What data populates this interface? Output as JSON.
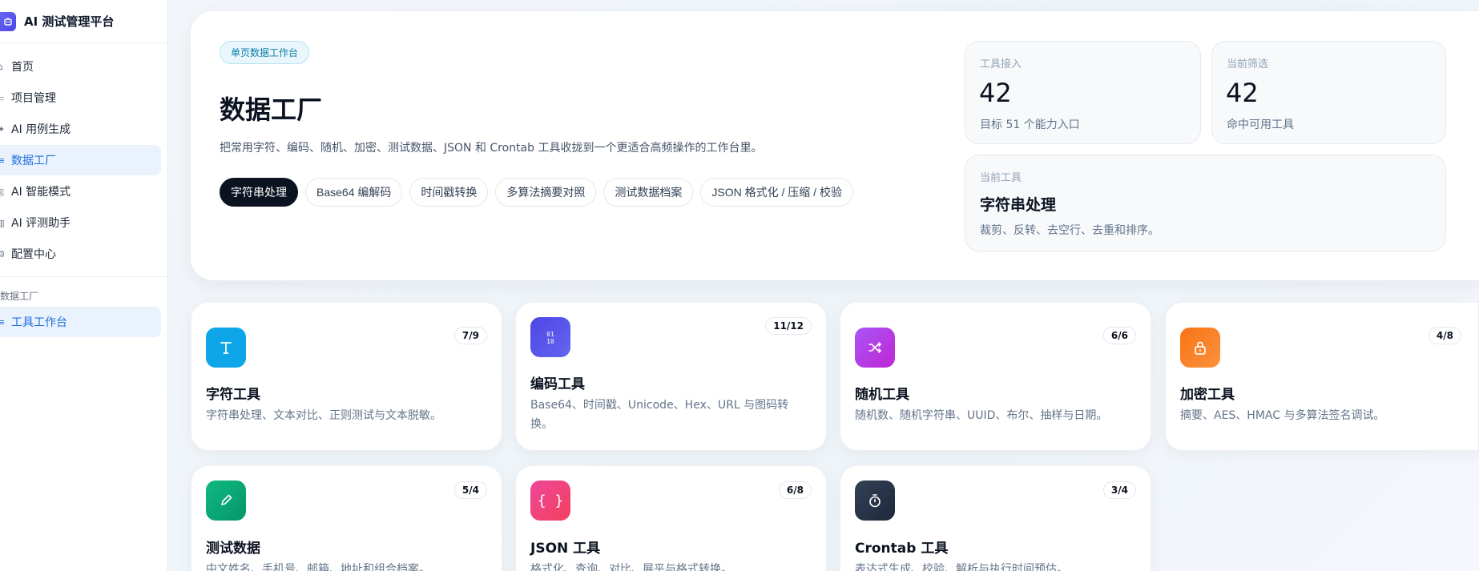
{
  "sidebar": {
    "brand": "AI 测试管理平台",
    "items": [
      {
        "label": "首页",
        "active": false
      },
      {
        "label": "项目管理",
        "active": false
      },
      {
        "label": "AI 用例生成",
        "active": false
      },
      {
        "label": "数据工厂",
        "active": true
      },
      {
        "label": "AI 智能模式",
        "active": false
      },
      {
        "label": "AI 评测助手",
        "active": false
      },
      {
        "label": "配置中心",
        "active": false
      }
    ],
    "section_title": "数据工厂",
    "section_items": [
      {
        "label": "工具工作台",
        "active": true
      }
    ]
  },
  "hero": {
    "tag": "单页数据工作台",
    "title": "数据工厂",
    "description": "把常用字符、编码、随机、加密、测试数据、JSON 和 Crontab 工具收拢到一个更适合高频操作的工作台里。",
    "chips": [
      {
        "label": "字符串处理",
        "active": true
      },
      {
        "label": "Base64 编解码",
        "active": false
      },
      {
        "label": "时间戳转换",
        "active": false
      },
      {
        "label": "多算法摘要对照",
        "active": false
      },
      {
        "label": "测试数据档案",
        "active": false
      },
      {
        "label": "JSON 格式化 / 压缩 / 校验",
        "active": false
      }
    ]
  },
  "stats": {
    "tools": {
      "label": "工具接入",
      "value": "42",
      "sub": "目标 51 个能力入口"
    },
    "filter": {
      "label": "当前筛选",
      "value": "42",
      "sub": "命中可用工具"
    },
    "current": {
      "label": "当前工具",
      "name": "字符串处理",
      "sub": "裁剪、反转、去空行、去重和排序。"
    }
  },
  "cards": [
    {
      "title": "字符工具",
      "desc": "字符串处理、文本对比、正则测试与文本脱敏。",
      "badge": "7/9",
      "icon": "text-icon",
      "color": "#0ea5e9"
    },
    {
      "title": "编码工具",
      "desc": "Base64、时间戳、Unicode、Hex、URL 与图码转换。",
      "badge": "11/12",
      "icon": "binary-icon",
      "color": "#4f46e5"
    },
    {
      "title": "随机工具",
      "desc": "随机数、随机字符串、UUID、布尔、抽样与日期。",
      "badge": "6/6",
      "icon": "shuffle-icon",
      "color": "#a855f7"
    },
    {
      "title": "加密工具",
      "desc": "摘要、AES、HMAC 与多算法签名调试。",
      "badge": "4/8",
      "icon": "lock-icon",
      "color": "#f97316"
    },
    {
      "title": "测试数据",
      "desc": "中文姓名、手机号、邮箱、地址和组合档案。",
      "badge": "5/4",
      "icon": "pen-icon",
      "color": "#10b981"
    },
    {
      "title": "JSON 工具",
      "desc": "格式化、查询、对比、展平与格式转换。",
      "badge": "6/8",
      "icon": "braces-icon",
      "color": "#ec4899"
    },
    {
      "title": "Crontab 工具",
      "desc": "表达式生成、校验、解析与执行时间预估。",
      "badge": "3/4",
      "icon": "timer-icon",
      "color": "#334155"
    }
  ]
}
